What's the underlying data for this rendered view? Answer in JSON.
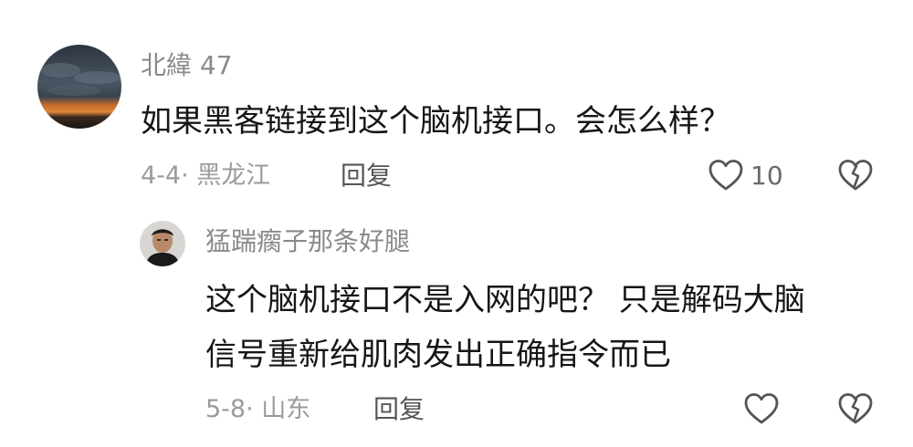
{
  "comments": [
    {
      "username": "北緯 47",
      "text": "如果黑客链接到这个脑机接口。会怎么样？",
      "date": "4-4",
      "separator": "·",
      "location": "黑龙江",
      "reply_label": "回复",
      "like_count": "10",
      "avatar_icon": "sunset-sky-avatar",
      "replies": [
        {
          "username": "猛踹瘸子那条好腿",
          "text_line1": "这个脑机接口不是入网的吧？  只是解码大脑",
          "text_line2": "信号重新给肌肉发出正确指令而已",
          "date": "5-8",
          "separator": "·",
          "location": "山东",
          "reply_label": "回复",
          "like_count": "",
          "avatar_icon": "man-portrait-avatar"
        }
      ]
    }
  ],
  "icons": {
    "like": "heart-outline-icon",
    "dislike": "broken-heart-icon"
  },
  "colors": {
    "text": "#161616",
    "username": "#8a8a8a",
    "meta": "#9b9b9b",
    "icon": "#555555"
  }
}
